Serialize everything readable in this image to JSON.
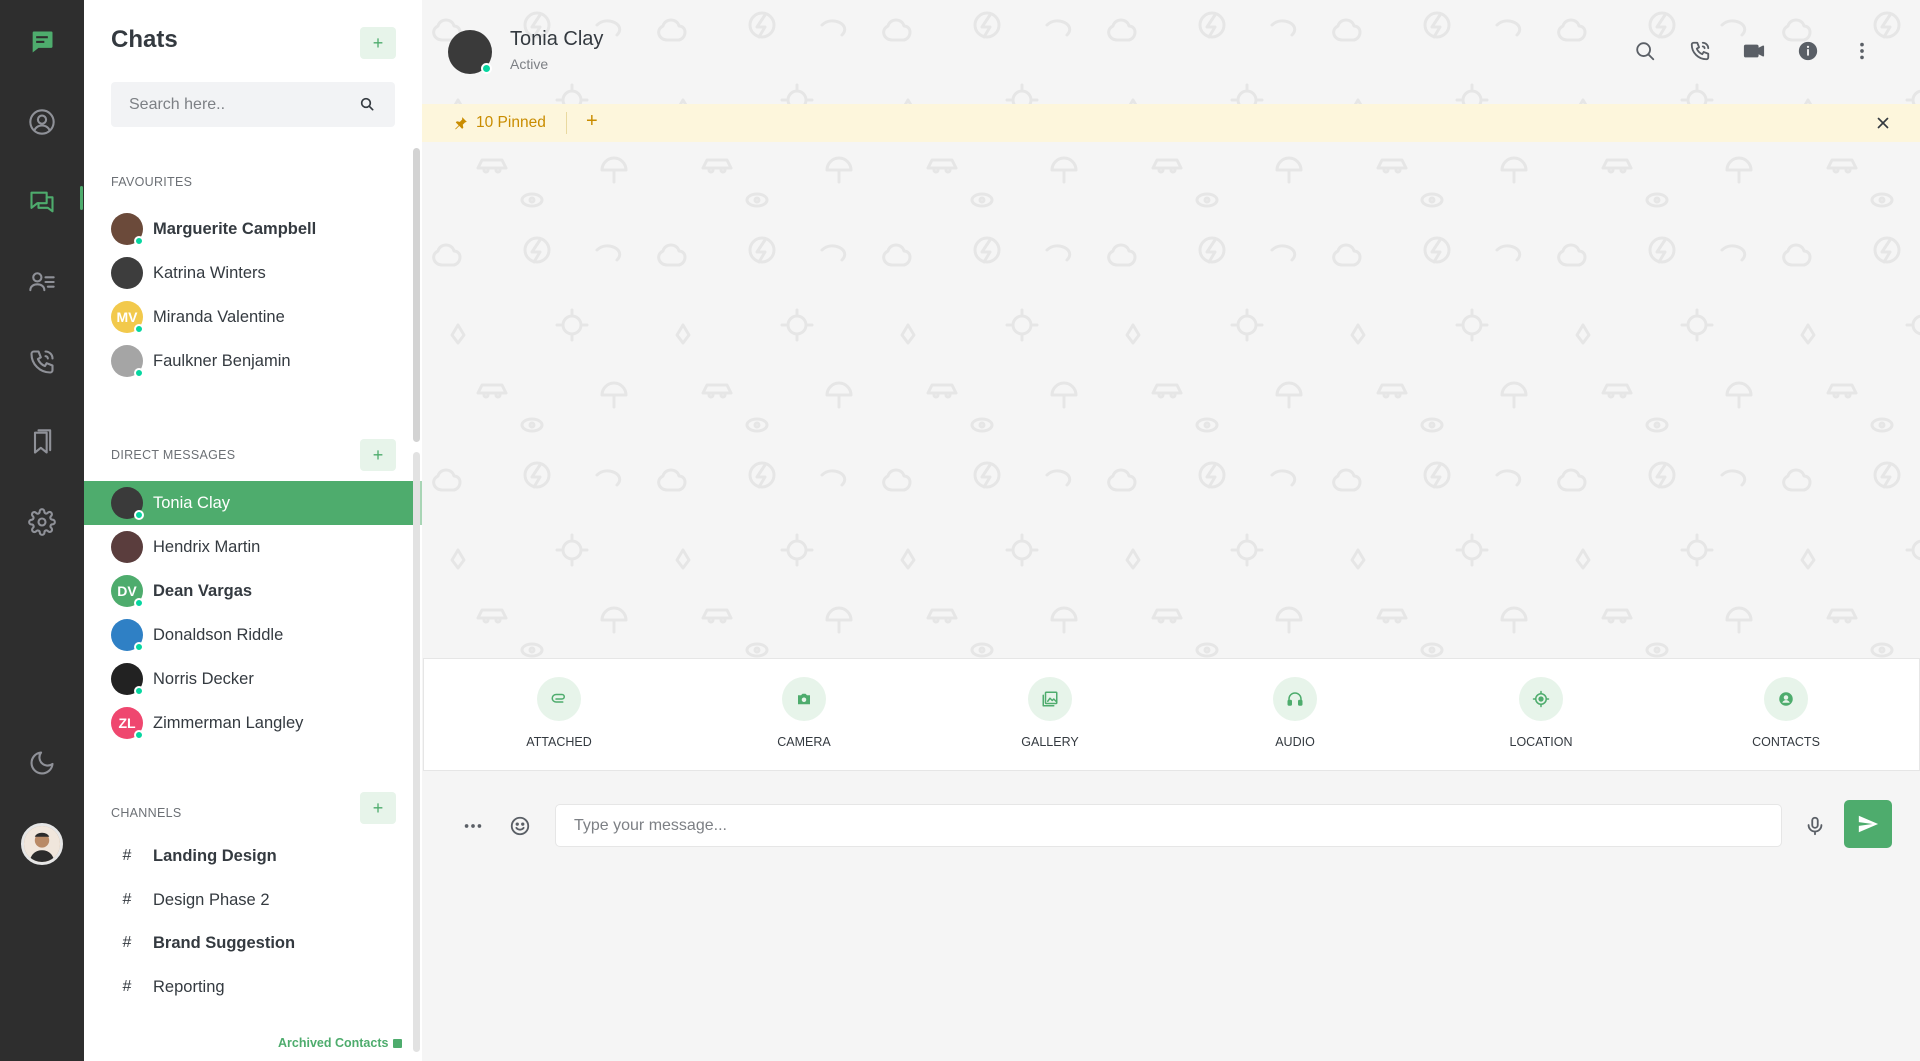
{
  "colors": {
    "accent": "#4eac6d",
    "rail_bg": "#2e2e2e",
    "pinned_bg": "#fdf6dc",
    "pinned_text": "#c98c00",
    "online": "#06d6a0"
  },
  "rail": {
    "items": [
      {
        "icon": "logo-chat-icon"
      },
      {
        "icon": "profile-icon"
      },
      {
        "icon": "chats-icon"
      },
      {
        "icon": "contacts-icon"
      },
      {
        "icon": "calls-icon"
      },
      {
        "icon": "bookmarks-icon"
      },
      {
        "icon": "settings-icon"
      },
      {
        "icon": "dark-mode-moon-icon"
      }
    ]
  },
  "sidebar": {
    "title": "Chats",
    "add_label": "+",
    "search_placeholder": "Search here..",
    "favourites_label": "FAVOURITES",
    "favourites": [
      {
        "name": "Marguerite Campbell",
        "bold": true,
        "online": true,
        "avatar_color": "#6b4a3a"
      },
      {
        "name": "Katrina Winters",
        "bold": false,
        "online": false,
        "avatar_color": "#3d3d3d"
      },
      {
        "name": "Miranda Valentine",
        "bold": false,
        "online": true,
        "initials": "MV",
        "avatar_color": "#f2c94c"
      },
      {
        "name": "Faulkner Benjamin",
        "bold": false,
        "online": true,
        "avatar_color": "#a5a5a5"
      }
    ],
    "direct_label": "DIRECT MESSAGES",
    "direct": [
      {
        "name": "Tonia Clay",
        "active": true,
        "online": true,
        "avatar_color": "#3a3a3a"
      },
      {
        "name": "Hendrix Martin",
        "online": false,
        "avatar_color": "#5a3d3d"
      },
      {
        "name": "Dean Vargas",
        "bold": true,
        "online": true,
        "initials": "DV",
        "avatar_color": "#4eac6d"
      },
      {
        "name": "Donaldson Riddle",
        "online": true,
        "avatar_color": "#2f80c5"
      },
      {
        "name": "Norris Decker",
        "online": true,
        "avatar_color": "#222222"
      },
      {
        "name": "Zimmerman Langley",
        "online": true,
        "initials": "ZL",
        "avatar_color": "#ef476f"
      }
    ],
    "channels_label": "CHANNELS",
    "channels": [
      {
        "name": "Landing Design",
        "bold": true
      },
      {
        "name": "Design Phase 2",
        "bold": false
      },
      {
        "name": "Brand Suggestion",
        "bold": true
      },
      {
        "name": "Reporting",
        "bold": false
      }
    ],
    "hash": "#",
    "archived": "Archived Contacts"
  },
  "chat": {
    "name": "Tonia Clay",
    "status": "Active",
    "header_icons": [
      "search-icon",
      "phone-icon",
      "video-icon",
      "info-icon",
      "more-vertical-icon"
    ],
    "pinned": {
      "label": "10 Pinned",
      "add": "+"
    },
    "attachments": [
      {
        "label": "ATTACHED",
        "icon": "paperclip-icon"
      },
      {
        "label": "CAMERA",
        "icon": "camera-icon"
      },
      {
        "label": "GALLERY",
        "icon": "gallery-icon"
      },
      {
        "label": "AUDIO",
        "icon": "headphones-icon"
      },
      {
        "label": "LOCATION",
        "icon": "location-icon"
      },
      {
        "label": "CONTACTS",
        "icon": "contact-icon"
      }
    ],
    "composer": {
      "placeholder": "Type your message..."
    }
  }
}
